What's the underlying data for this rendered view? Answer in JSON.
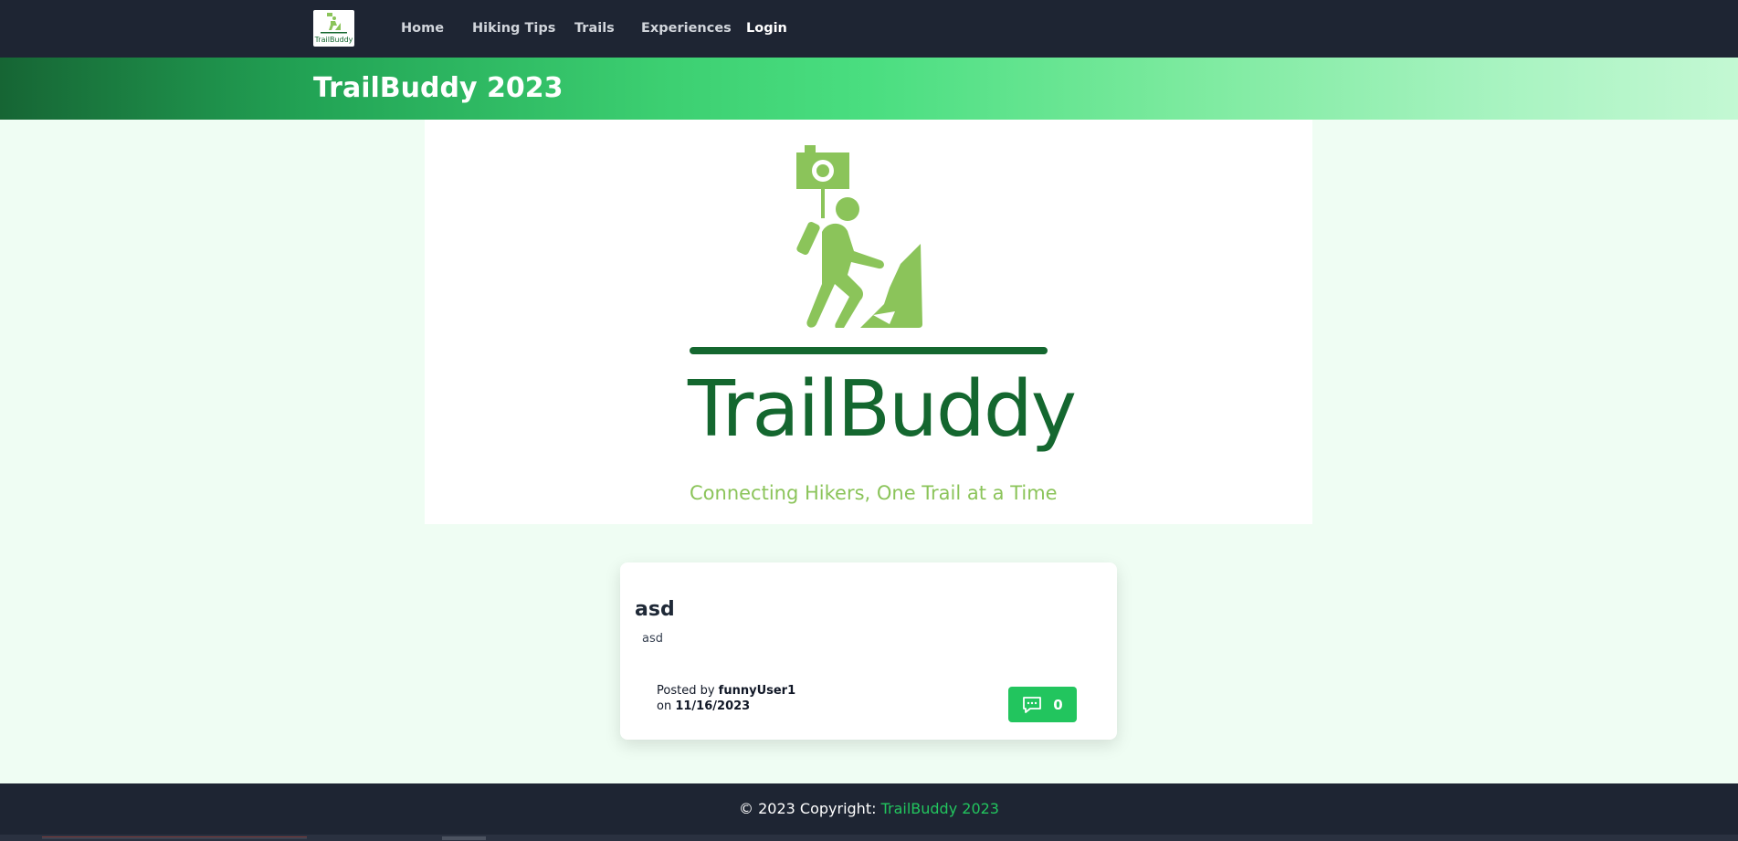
{
  "nav": {
    "logo_label": "TrailBuddy",
    "links": [
      {
        "label": "Home"
      },
      {
        "label": "Hiking Tips"
      },
      {
        "label": "Trails"
      },
      {
        "label": "Experiences"
      },
      {
        "label": "Login"
      }
    ]
  },
  "banner": {
    "title": "TrailBuddy 2023"
  },
  "hero": {
    "brand": "TrailBuddy",
    "tagline": "Connecting Hikers, One Trail at a Time"
  },
  "post": {
    "title": "asd",
    "body": "asd",
    "posted_by_prefix": "Posted by",
    "author": "funnyUser1",
    "on_prefix": "on",
    "date": "11/16/2023",
    "comment_count": "0"
  },
  "footer": {
    "prefix": "© 2023 Copyright:",
    "link_label": "TrailBuddy 2023"
  },
  "colors": {
    "nav_bg": "#1e2533",
    "accent_green": "#22c55e",
    "brand_dark_green": "#14672f",
    "brand_light_green": "#8bc45a",
    "page_bg": "#effdf3"
  }
}
